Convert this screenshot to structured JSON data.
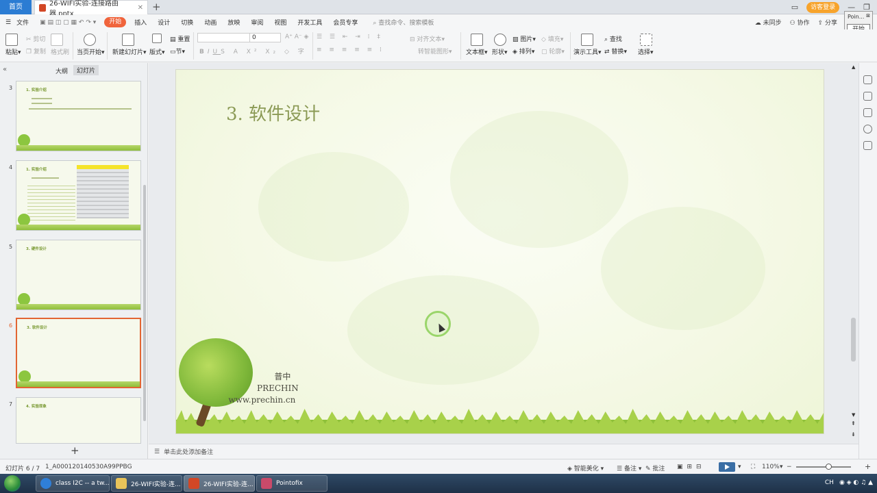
{
  "titlebar": {
    "home_tab": "首页",
    "doc_tab": "26-WIFI实验-连接路由器.pptx",
    "visitor_label": "访客登录"
  },
  "menu": {
    "file": "文件",
    "items": [
      "开始",
      "插入",
      "设计",
      "切换",
      "动画",
      "放映",
      "审阅",
      "视图",
      "开发工具",
      "会员专享"
    ],
    "active_index": 0,
    "search_placeholder": "查找命令、搜索模板",
    "right_items": [
      "未同步",
      "协作",
      "分享"
    ]
  },
  "toolbar": {
    "paste": "粘贴",
    "cut": "剪切",
    "copy": "复制",
    "format_painter": "格式刷",
    "from_current": "当页开始",
    "new_slide": "新建幻灯片",
    "layout": "版式",
    "reset": "重置",
    "section": "节",
    "font_size": "0",
    "align_text": "对齐文本",
    "convert_smartart": "转智能图形",
    "textbox": "文本框",
    "shape": "形状",
    "picture": "图片",
    "arrange": "排列",
    "fill": "填充",
    "outline": "轮廓",
    "presentation_tools": "演示工具",
    "find": "查找",
    "replace": "替换",
    "select": "选择"
  },
  "leftpane": {
    "tabs": [
      "大纲",
      "幻灯片"
    ],
    "thumbnails": [
      {
        "num": "3",
        "title": "1. 实验介绍",
        "selected": false
      },
      {
        "num": "4",
        "title": "1. 实验介绍",
        "selected": false
      },
      {
        "num": "5",
        "title": "3. 硬件设计",
        "selected": false
      },
      {
        "num": "6",
        "title": "3. 软件设计",
        "selected": true
      },
      {
        "num": "7",
        "title": "4. 实验现象",
        "selected": false
      }
    ],
    "add_slide": "+"
  },
  "slide": {
    "title": "3. 软件设计",
    "logo_line1": "普中",
    "logo_line2": "PRECHIN",
    "logo_line3": "www.prechin.cn"
  },
  "notes": {
    "placeholder": "单击此处添加备注"
  },
  "status": {
    "slide_counter": "幻灯片 6 / 7",
    "theme_name": "1_A000120140530A99PPBG",
    "smart_beautify": "智能美化",
    "notes": "备注",
    "comments": "批注",
    "zoom": "110%"
  },
  "taskbar": {
    "items": [
      {
        "label": "class I2C -- a tw...",
        "color": "#2f7fd8"
      },
      {
        "label": "26-WIFI实验-连...",
        "color": "#e8c35a"
      },
      {
        "label": "26-WIFI实验-连...",
        "color": "#d24726"
      },
      {
        "label": "Pointofix",
        "color": "#c94a6a"
      }
    ],
    "active_index": 2
  },
  "pointofix": {
    "title": "Poin...",
    "button": "开始"
  },
  "colors": {
    "accent": "#f0643c",
    "selection": "#e26533",
    "title_text": "#8b9a55",
    "slide_green": "#8cc63f"
  }
}
